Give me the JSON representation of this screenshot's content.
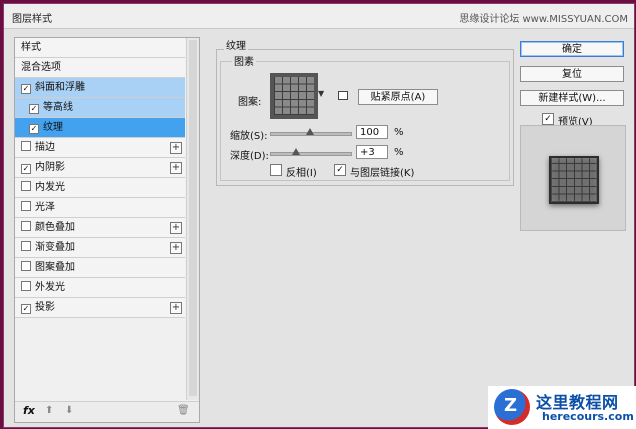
{
  "window": {
    "title": "图层样式",
    "watermark": "思缘设计论坛 www.MISSYUAN.COM"
  },
  "styles_panel": {
    "items": [
      {
        "label": "样式",
        "checkbox": false,
        "checked": false,
        "plus": false,
        "state": "header"
      },
      {
        "label": "混合选项",
        "checkbox": false,
        "checked": false,
        "plus": false,
        "state": "header"
      },
      {
        "label": "斜面和浮雕",
        "checkbox": true,
        "checked": true,
        "plus": false,
        "state": "parent-selected"
      },
      {
        "label": "等高线",
        "checkbox": true,
        "checked": true,
        "plus": false,
        "state": "sub"
      },
      {
        "label": "纹理",
        "checkbox": true,
        "checked": true,
        "plus": false,
        "state": "active"
      },
      {
        "label": "描边",
        "checkbox": true,
        "checked": false,
        "plus": true,
        "state": "normal"
      },
      {
        "label": "内阴影",
        "checkbox": true,
        "checked": true,
        "plus": true,
        "state": "normal"
      },
      {
        "label": "内发光",
        "checkbox": true,
        "checked": false,
        "plus": false,
        "state": "normal"
      },
      {
        "label": "光泽",
        "checkbox": true,
        "checked": false,
        "plus": false,
        "state": "normal"
      },
      {
        "label": "颜色叠加",
        "checkbox": true,
        "checked": false,
        "plus": true,
        "state": "normal"
      },
      {
        "label": "渐变叠加",
        "checkbox": true,
        "checked": false,
        "plus": true,
        "state": "normal"
      },
      {
        "label": "图案叠加",
        "checkbox": true,
        "checked": false,
        "plus": false,
        "state": "normal"
      },
      {
        "label": "外发光",
        "checkbox": true,
        "checked": false,
        "plus": false,
        "state": "normal"
      },
      {
        "label": "投影",
        "checkbox": true,
        "checked": true,
        "plus": true,
        "state": "normal"
      }
    ],
    "footer": {
      "fx_label": "fx",
      "move_up": "⬆",
      "move_down": "⬇",
      "delete": "🗑"
    }
  },
  "texture": {
    "group_title": "纹理",
    "sub_title": "图素",
    "pattern_label": "图案:",
    "snap_button": "贴紧原点(A)",
    "scale_label": "缩放(S):",
    "scale_value": "100",
    "scale_unit": "%",
    "scale_level": 0.5,
    "depth_label": "深度(D):",
    "depth_value": "+3",
    "depth_unit": "%",
    "depth_level": 0.33,
    "invert_label": "反相(I)",
    "invert_checked": false,
    "link_label": "与图层链接(K)",
    "link_checked": true
  },
  "actions": {
    "ok": "确定",
    "reset": "复位",
    "new_style": "新建样式(W)...",
    "preview_label": "预览(V)",
    "preview_checked": true
  },
  "logo": {
    "cn": "这里教程网",
    "en": "herecours.com",
    "mark": "Z"
  }
}
